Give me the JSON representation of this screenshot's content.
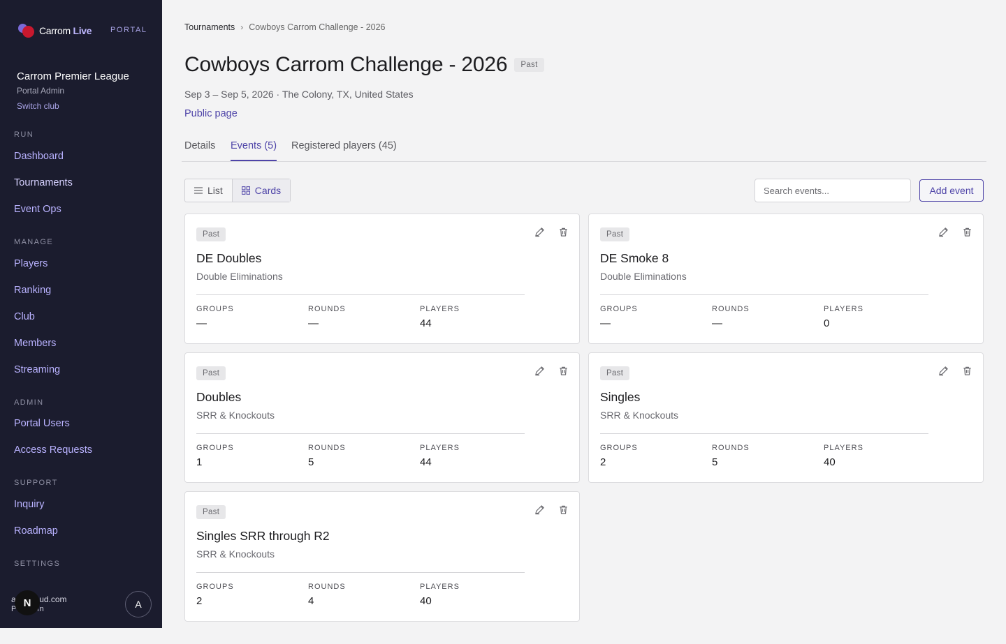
{
  "sidebar": {
    "brand_name_a": "Carrom",
    "brand_name_b": "Live",
    "portal_tag": "PORTAL",
    "club_name": "Carrom Premier League",
    "club_role": "Portal Admin",
    "switch_club": "Switch club",
    "sections": {
      "run": "RUN",
      "manage": "MANAGE",
      "admin": "ADMIN",
      "support": "SUPPORT",
      "settings": "SETTINGS"
    },
    "items": {
      "dashboard": "Dashboard",
      "tournaments": "Tournaments",
      "event_ops": "Event Ops",
      "players": "Players",
      "ranking": "Ranking",
      "club": "Club",
      "members": "Members",
      "streaming": "Streaming",
      "portal_users": "Portal Users",
      "access_requests": "Access Requests",
      "inquiry": "Inquiry",
      "roadmap": "Roadmap"
    },
    "user": {
      "email": "a      @icloud.com",
      "role": "P     Admin",
      "avatar_n": "N",
      "avatar_a": "A"
    }
  },
  "breadcrumb": {
    "root": "Tournaments",
    "sep": "›",
    "current": "Cowboys Carrom Challenge - 2026"
  },
  "header": {
    "title": "Cowboys Carrom Challenge - 2026",
    "status": "Past",
    "subline": "Sep 3 – Sep 5, 2026 · The Colony, TX, United States",
    "public_link": "Public page"
  },
  "tabs": {
    "details": "Details",
    "events": "Events (5)",
    "players": "Registered players (45)"
  },
  "toolbar": {
    "list": "List",
    "cards": "Cards",
    "search_placeholder": "Search events...",
    "add_event": "Add event"
  },
  "stat_labels": {
    "groups": "GROUPS",
    "rounds": "ROUNDS",
    "players": "PLAYERS"
  },
  "events": [
    {
      "status": "Past",
      "name": "DE Doubles",
      "format": "Double Eliminations",
      "groups": "—",
      "rounds": "—",
      "players": "44"
    },
    {
      "status": "Past",
      "name": "DE Smoke 8",
      "format": "Double Eliminations",
      "groups": "—",
      "rounds": "—",
      "players": "0"
    },
    {
      "status": "Past",
      "name": "Doubles",
      "format": "SRR & Knockouts",
      "groups": "1",
      "rounds": "5",
      "players": "44"
    },
    {
      "status": "Past",
      "name": "Singles",
      "format": "SRR & Knockouts",
      "groups": "2",
      "rounds": "5",
      "players": "40"
    },
    {
      "status": "Past",
      "name": "Singles SRR through R2",
      "format": "SRR & Knockouts",
      "groups": "2",
      "rounds": "4",
      "players": "40"
    }
  ],
  "colors": {
    "sidebar_bg": "#1b1c2e",
    "accent": "#4e44a8",
    "nav_link": "#b9b2ff"
  }
}
